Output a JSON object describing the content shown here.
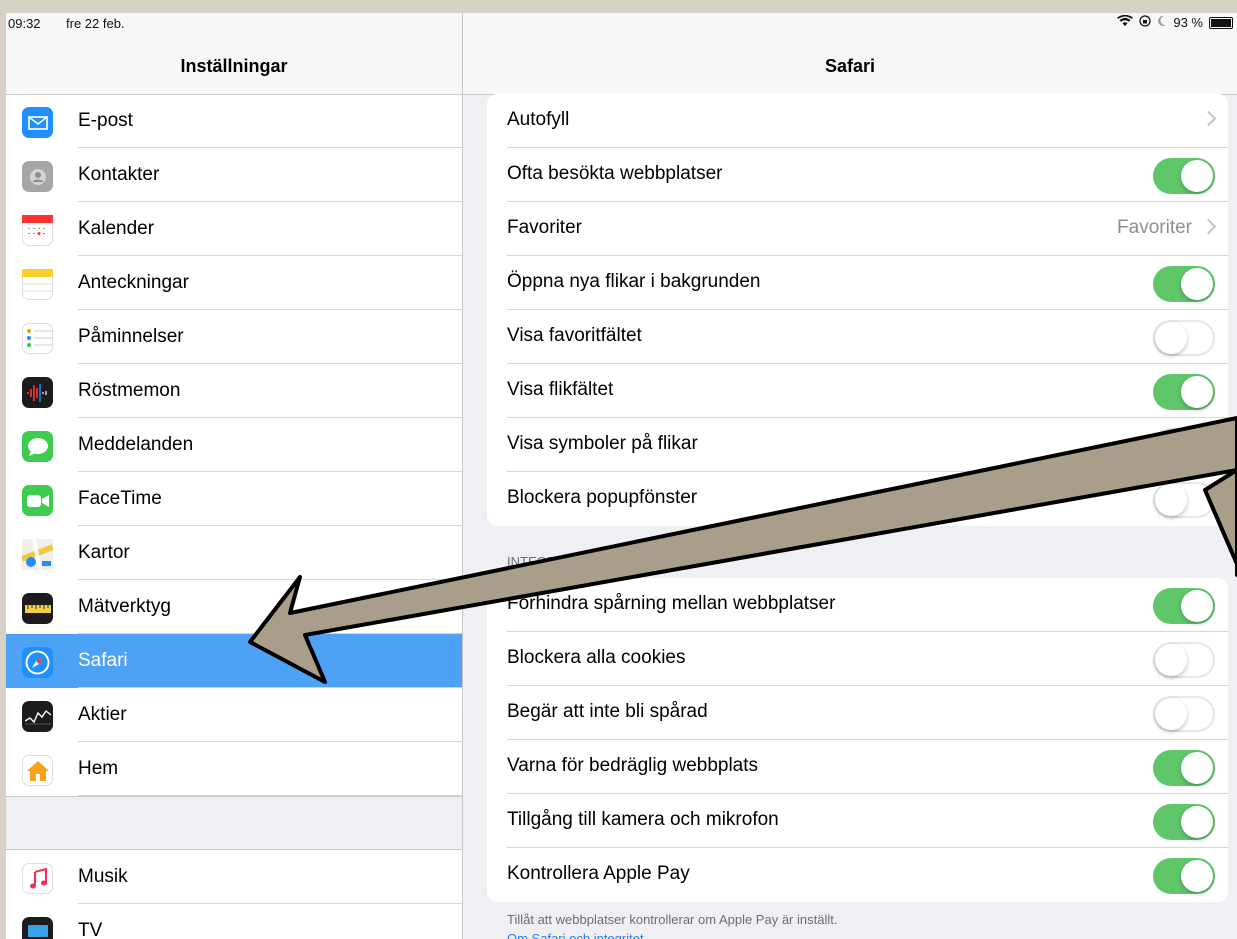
{
  "status_bar": {
    "time": "09:32",
    "date": "fre 22 feb.",
    "battery": "93 %",
    "battery_level": 0.93
  },
  "sidebar": {
    "title": "Inställningar",
    "items": [
      {
        "label": "E-post",
        "icon": "mail-icon",
        "color": "#1e8ffb"
      },
      {
        "label": "Kontakter",
        "icon": "contacts-icon",
        "color": "#a7a6a6"
      },
      {
        "label": "Kalender",
        "icon": "calendar-icon",
        "color": "#ffffff"
      },
      {
        "label": "Anteckningar",
        "icon": "notes-icon",
        "color": "#ffffff"
      },
      {
        "label": "Påminnelser",
        "icon": "reminders-icon",
        "color": "#ffffff"
      },
      {
        "label": "Röstmemon",
        "icon": "voice-memos-icon",
        "color": "#1c1c1e"
      },
      {
        "label": "Meddelanden",
        "icon": "messages-icon",
        "color": "#3fcb4f"
      },
      {
        "label": "FaceTime",
        "icon": "facetime-icon",
        "color": "#3fcb4f"
      },
      {
        "label": "Kartor",
        "icon": "maps-icon",
        "color": "#7ac27a"
      },
      {
        "label": "Mätverktyg",
        "icon": "measure-icon",
        "color": "#1c1c1e"
      },
      {
        "label": "Safari",
        "icon": "safari-icon",
        "color": "#1e8ffb",
        "selected": true
      },
      {
        "label": "Aktier",
        "icon": "stocks-icon",
        "color": "#1c1c1e"
      },
      {
        "label": "Hem",
        "icon": "home-icon",
        "color": "#ffffff"
      }
    ],
    "items2": [
      {
        "label": "Musik",
        "icon": "music-icon",
        "color": "#ffffff"
      },
      {
        "label": "TV",
        "icon": "tv-icon",
        "color": "#1c1c1e"
      }
    ]
  },
  "detail": {
    "title": "Safari",
    "group1": [
      {
        "label": "Autofyll",
        "type": "chevron"
      },
      {
        "label": "Ofta besökta webbplatser",
        "type": "toggle",
        "on": true
      },
      {
        "label": "Favoriter",
        "type": "chevron",
        "value": "Favoriter"
      },
      {
        "label": "Öppna nya flikar i bakgrunden",
        "type": "toggle",
        "on": true
      },
      {
        "label": "Visa favoritfältet",
        "type": "toggle",
        "on": false
      },
      {
        "label": "Visa flikfältet",
        "type": "toggle",
        "on": true
      },
      {
        "label": "Visa symboler på flikar",
        "type": "toggle",
        "on": false
      },
      {
        "label": "Blockera popupfönster",
        "type": "toggle",
        "on": false
      }
    ],
    "section_header": "INTEGRI",
    "group2": [
      {
        "label": "Förhindra spårning mellan webbplatser",
        "type": "toggle",
        "on": true
      },
      {
        "label": "Blockera alla cookies",
        "type": "toggle",
        "on": false
      },
      {
        "label": "Begär att inte bli spårad",
        "type": "toggle",
        "on": false
      },
      {
        "label": "Varna för bedräglig webbplats",
        "type": "toggle",
        "on": true
      },
      {
        "label": "Tillgång till kamera och mikrofon",
        "type": "toggle",
        "on": true
      },
      {
        "label": "Kontrollera Apple Pay",
        "type": "toggle",
        "on": true
      }
    ],
    "footer_text": "Tillåt att webbplatser kontrollerar om Apple Pay är inställt.",
    "footer_link": "Om Safari och integritet"
  },
  "colors": {
    "accent": "#4da2f6",
    "toggle_on": "#5fc66a",
    "arrow_fill": "#a89e8a"
  }
}
